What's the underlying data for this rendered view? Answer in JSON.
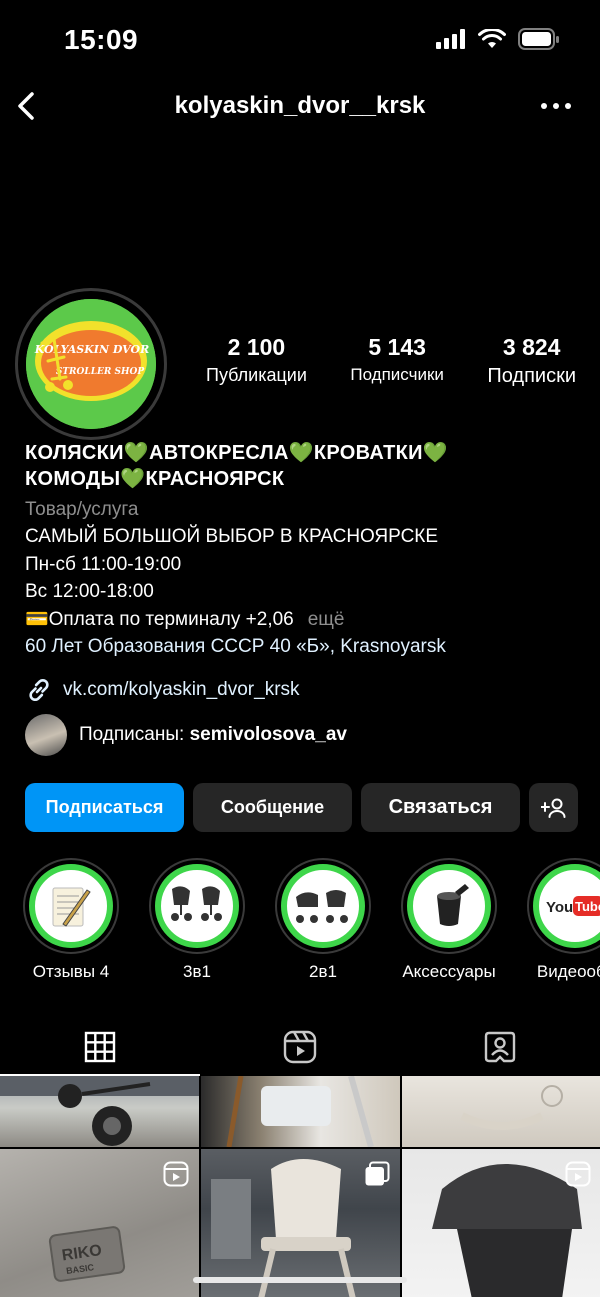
{
  "status_bar": {
    "time": "15:09"
  },
  "nav": {
    "username": "kolyaskin_dvor__krsk"
  },
  "profile": {
    "logo_text_top": "KOLYASKIN DVOR",
    "logo_text_bottom": "STROLLER SHOP",
    "stats": [
      {
        "value": "2 100",
        "label": "Публикации"
      },
      {
        "value": "5 143",
        "label": "Подписчики"
      },
      {
        "value": "3 824",
        "label": "Подписки"
      }
    ]
  },
  "bio": {
    "name_line1": "КОЛЯСКИ💚АВТОКРЕСЛА💚КРОВАТКИ💚",
    "name_line2": "КОМОДЫ💚КРАСНОЯРСК",
    "category": "Товар/услуга",
    "lines": [
      "САМЫЙ БОЛЬШОЙ ВЫБОР В КРАСНОЯРСКЕ",
      "Пн-сб 11:00-19:00",
      "Вс 12:00-18:00"
    ],
    "payment_line": "💳Оплата по терминалу +2,06",
    "more": "ещё",
    "address": "60 Лет Образования СССР 40 «Б», Krasnoyarsk",
    "link": "vk.com/kolyaskin_dvor_krsk",
    "followed_by_prefix": "Подписаны: ",
    "followed_by_user": "semivolosova_av"
  },
  "buttons": {
    "follow": "Подписаться",
    "message": "Сообщение",
    "contact": "Связаться"
  },
  "highlights": [
    {
      "label": "Отзывы 4",
      "icon": "notepad-pen-icon"
    },
    {
      "label": "3в1",
      "icon": "strollers-icon"
    },
    {
      "label": "2в1",
      "icon": "strollers-icon"
    },
    {
      "label": "Аксессуары",
      "icon": "cup-holder-icon"
    },
    {
      "label": "Видеообз",
      "icon": "youtube-icon",
      "logo_text": "You",
      "logo_text_box": "Tube"
    }
  ],
  "tabs": [
    {
      "name": "grid-icon",
      "active": true
    },
    {
      "name": "reels-icon",
      "active": false
    },
    {
      "name": "tagged-icon",
      "active": false
    }
  ],
  "grid": {
    "brand_text_1": "RIKO",
    "brand_text_2": "BASIC"
  },
  "colors": {
    "accent": "#0095f6",
    "highlight_ring": "#3ed64a",
    "button_bg": "#262626",
    "secondary_text": "#8e8e8e"
  }
}
